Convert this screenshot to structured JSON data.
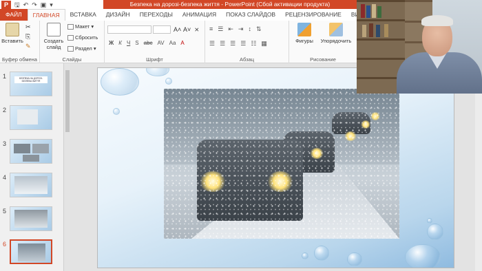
{
  "titlebar": {
    "title": "Безпека на дорозі-безпека життя -  PowerPoint (Сбой активации продукта)",
    "qat_icons": [
      "save-icon",
      "undo-icon",
      "redo-icon",
      "start-from-beginning-icon",
      "customize-icon"
    ]
  },
  "tabs": [
    "ФАЙЛ",
    "ГЛАВНАЯ",
    "ВСТАВКА",
    "ДИЗАЙН",
    "ПЕРЕХОДЫ",
    "АНИМАЦИЯ",
    "ПОКАЗ СЛАЙДОВ",
    "РЕЦЕНЗИРОВАНИЕ",
    "ВИД"
  ],
  "ribbon": {
    "clipboard": {
      "paste": "Вставить",
      "label": "Буфер обмена"
    },
    "slides": {
      "new_slide": "Создать слайд",
      "layout": "Макет",
      "reset": "Сбросить",
      "section": "Раздел",
      "label": "Слайды"
    },
    "font": {
      "bold": "Ж",
      "italic": "К",
      "underline": "Ч",
      "shadow": "S",
      "strike": "abc",
      "spacing": "AV",
      "case": "Aa",
      "label": "Шрифт"
    },
    "paragraph": {
      "label": "Абзац"
    },
    "drawing": {
      "shapes": "Фигуры",
      "arrange": "Упорядочить",
      "label": "Рисование"
    }
  },
  "slides": [
    {
      "num": "1",
      "title": "БЕЗПЕКА НА ДОРОЗІ- БЕЗПЕКА ЖИТТЯ"
    },
    {
      "num": "2"
    },
    {
      "num": "3"
    },
    {
      "num": "4"
    },
    {
      "num": "5"
    },
    {
      "num": "6",
      "selected": true
    }
  ],
  "colors": {
    "accent": "#d24726"
  }
}
